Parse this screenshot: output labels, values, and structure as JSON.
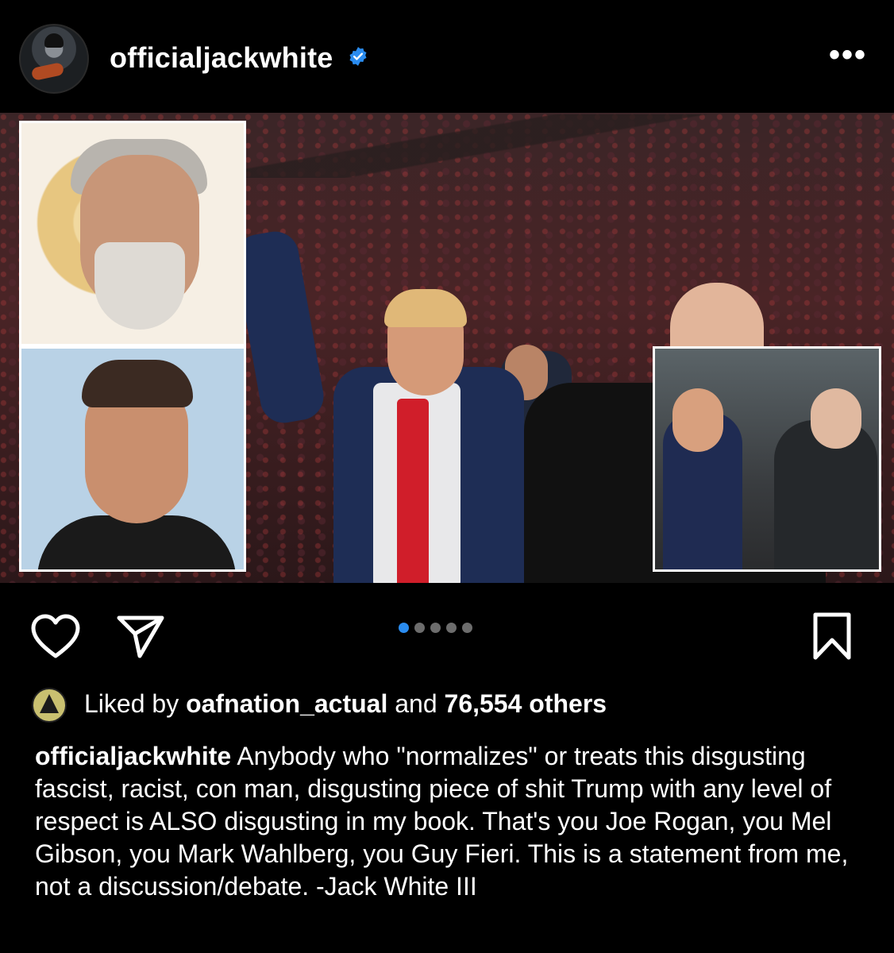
{
  "header": {
    "username": "officialjackwhite",
    "verified_icon": "verified-badge-icon",
    "more_label": "•••"
  },
  "post": {
    "carousel": {
      "count": 5,
      "active_index": 0
    }
  },
  "actions": {
    "like_icon": "heart-icon",
    "share_icon": "send-icon",
    "save_icon": "bookmark-icon"
  },
  "likes": {
    "prefix": "Liked by ",
    "user": "oafnation_actual",
    "middle": " and ",
    "count": "76,554 others"
  },
  "caption": {
    "username": "officialjackwhite",
    "text": " Anybody who \"normalizes\" or treats this disgusting fascist, racist, con man, disgusting piece of shit Trump with any level of respect is ALSO disgusting in my book. That's you Joe Rogan, you Mel Gibson, you Mark Wahlberg, you Guy Fieri. This is a statement from me, not a discussion/debate. -Jack White III"
  },
  "colors": {
    "accent": "#2a8cf0",
    "background": "#000000",
    "tie": "#d01e2a"
  }
}
